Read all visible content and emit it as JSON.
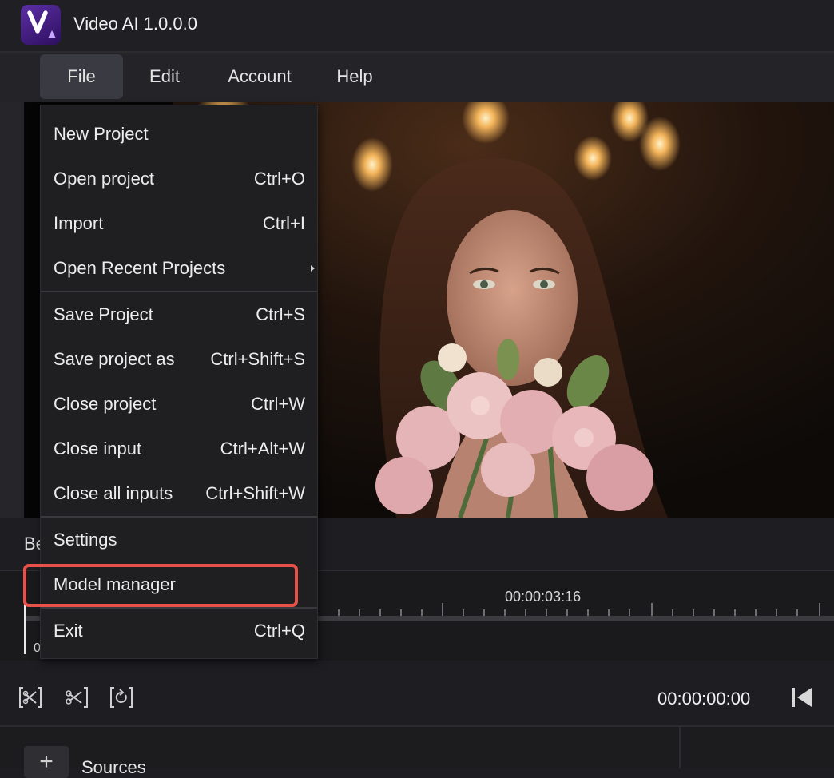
{
  "app": {
    "title": "Video AI 1.0.0.0",
    "logo_icon": "video-ai-logo-icon"
  },
  "menubar": {
    "items": [
      {
        "label": "File",
        "active": true
      },
      {
        "label": "Edit",
        "active": false
      },
      {
        "label": "Account",
        "active": false
      },
      {
        "label": "Help",
        "active": false
      }
    ]
  },
  "file_menu": {
    "items": [
      {
        "label": "New Project",
        "shortcut": ""
      },
      {
        "label": "Open project",
        "shortcut": "Ctrl+O"
      },
      {
        "label": "Import",
        "shortcut": "Ctrl+I"
      },
      {
        "label": "Open Recent Projects",
        "shortcut": "",
        "submenu": true
      },
      {
        "label": "Save Project",
        "shortcut": "Ctrl+S"
      },
      {
        "label": "Save project as",
        "shortcut": "Ctrl+Shift+S"
      },
      {
        "label": "Close project",
        "shortcut": "Ctrl+W"
      },
      {
        "label": "Close input",
        "shortcut": "Ctrl+Alt+W"
      },
      {
        "label": "Close all inputs",
        "shortcut": "Ctrl+Shift+W"
      },
      {
        "label": "Settings",
        "shortcut": ""
      },
      {
        "label": "Model manager",
        "shortcut": "",
        "highlighted": true
      },
      {
        "label": "Exit",
        "shortcut": "Ctrl+Q"
      }
    ],
    "highlight_color": "#e8504a"
  },
  "preview": {
    "before_label": "Be"
  },
  "timeline": {
    "marker_time": "00:00:03:16",
    "start_digit": "0"
  },
  "controls": {
    "icons": [
      "split-icon",
      "trim-icon",
      "reset-icon"
    ],
    "timecode": "00:00:00:00",
    "jump_start_icon": "skip-to-start-icon"
  },
  "sources": {
    "add_label": "+",
    "label": "Sources"
  },
  "colors": {
    "background": "#1e1e22",
    "menu_background": "#1f1f22",
    "active_menu": "#3a3b42",
    "logo": "#5c2fa6"
  }
}
